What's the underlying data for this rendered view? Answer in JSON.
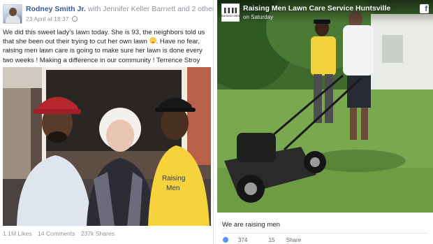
{
  "left_post": {
    "author": "Rodney Smith Jr.",
    "with_text": "with Jennifer Keller Barnett and 2 others.",
    "timestamp": "23 April at 18:37",
    "text_part1": "We did this sweet lady's lawn today. She is 93, the neighbors told us that she been out their trying to cut her own lawn",
    "text_part2": ". Have no fear, raising men lawn care is going to make sure her lawn is done every two weeks ! Making a difference in our community ! Terrence Stroy",
    "emoji": "smile-emoji",
    "stats": {
      "likes": "1.1M Likes",
      "comments": "14 Comments",
      "shares": "237k Shares"
    }
  },
  "right_post": {
    "page_name": "Raising Men Lawn Care Service Huntsville",
    "time": "on Saturday",
    "logo_text": "RAISING MEN",
    "caption": "We are raising men",
    "actions": {
      "likes": "374",
      "comments": "15",
      "share": "Share"
    }
  },
  "colors": {
    "link_blue": "#365899",
    "facebook_blue": "#3b5998",
    "muted_gray": "#90949c",
    "grass_green": "#5b8a3c"
  },
  "icons": [
    "globe-icon",
    "facebook-icon",
    "smile-emoji",
    "like-icon"
  ]
}
